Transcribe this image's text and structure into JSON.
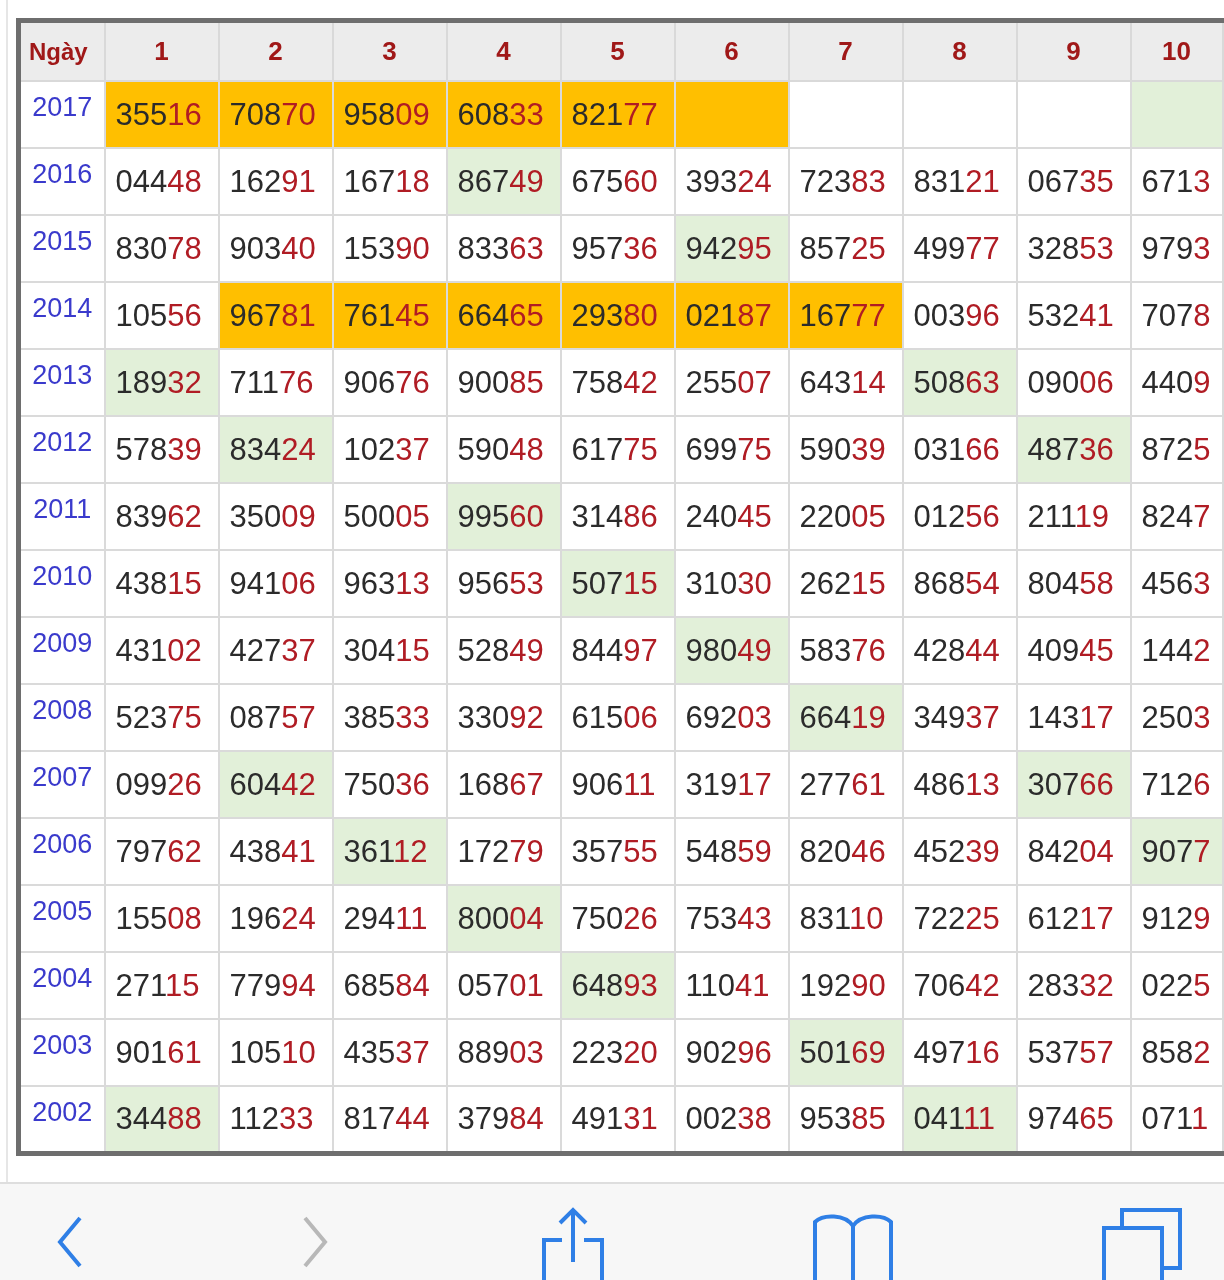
{
  "table": {
    "corner_label": "Ngày",
    "columns": [
      "1",
      "2",
      "3",
      "4",
      "5",
      "6",
      "7",
      "8",
      "9",
      "10"
    ],
    "rows": [
      {
        "year": "2017",
        "cells": [
          {
            "value": "35516",
            "color": "#ffbf00"
          },
          {
            "value": "70870",
            "color": "#ffbf00"
          },
          {
            "value": "95809",
            "color": "#ffbf00"
          },
          {
            "value": "60833",
            "color": "#ffbf00"
          },
          {
            "value": "82177",
            "color": "#ffbf00"
          },
          {
            "color": "#ffbf00"
          },
          {
            "color": "#ffffff"
          },
          {
            "color": "#ffffff"
          },
          {
            "color": "#ffffff"
          },
          {
            "color": "#e2f0d9"
          }
        ]
      },
      {
        "year": "2016",
        "cells": [
          {
            "value": "04448",
            "color": "#ffffff"
          },
          {
            "value": "16291",
            "color": "#ffffff"
          },
          {
            "value": "16718",
            "color": "#ffffff"
          },
          {
            "value": "86749",
            "color": "#e2f0d9"
          },
          {
            "value": "67560",
            "color": "#ffffff"
          },
          {
            "value": "39324",
            "color": "#ffffff"
          },
          {
            "value": "72383",
            "color": "#ffffff"
          },
          {
            "value": "83121",
            "color": "#ffffff"
          },
          {
            "value": "06735",
            "color": "#ffffff"
          },
          {
            "value": "6713",
            "color": "#ffffff"
          }
        ]
      },
      {
        "year": "2015",
        "cells": [
          {
            "value": "83078",
            "color": "#ffffff"
          },
          {
            "value": "90340",
            "color": "#ffffff"
          },
          {
            "value": "15390",
            "color": "#ffffff"
          },
          {
            "value": "83363",
            "color": "#ffffff"
          },
          {
            "value": "95736",
            "color": "#ffffff"
          },
          {
            "value": "94295",
            "color": "#e2f0d9"
          },
          {
            "value": "85725",
            "color": "#ffffff"
          },
          {
            "value": "49977",
            "color": "#ffffff"
          },
          {
            "value": "32853",
            "color": "#ffffff"
          },
          {
            "value": "9793",
            "color": "#ffffff"
          }
        ]
      },
      {
        "year": "2014",
        "cells": [
          {
            "value": "10556",
            "color": "#ffffff"
          },
          {
            "value": "96781",
            "color": "#ffbf00"
          },
          {
            "value": "76145",
            "color": "#ffbf00"
          },
          {
            "value": "66465",
            "color": "#ffbf00"
          },
          {
            "value": "29380",
            "color": "#ffbf00"
          },
          {
            "value": "02187",
            "color": "#ffbf00"
          },
          {
            "value": "16777",
            "color": "#ffbf00"
          },
          {
            "value": "00396",
            "color": "#ffffff"
          },
          {
            "value": "53241",
            "color": "#ffffff"
          },
          {
            "value": "7078",
            "color": "#ffffff"
          }
        ]
      },
      {
        "year": "2013",
        "cells": [
          {
            "value": "18932",
            "color": "#e2f0d9"
          },
          {
            "value": "71176",
            "color": "#ffffff"
          },
          {
            "value": "90676",
            "color": "#ffffff"
          },
          {
            "value": "90085",
            "color": "#ffffff"
          },
          {
            "value": "75842",
            "color": "#ffffff"
          },
          {
            "value": "25507",
            "color": "#ffffff"
          },
          {
            "value": "64314",
            "color": "#ffffff"
          },
          {
            "value": "50863",
            "color": "#e2f0d9"
          },
          {
            "value": "09006",
            "color": "#ffffff"
          },
          {
            "value": "4409",
            "color": "#ffffff"
          }
        ]
      },
      {
        "year": "2012",
        "cells": [
          {
            "value": "57839",
            "color": "#ffffff"
          },
          {
            "value": "83424",
            "color": "#e2f0d9"
          },
          {
            "value": "10237",
            "color": "#ffffff"
          },
          {
            "value": "59048",
            "color": "#ffffff"
          },
          {
            "value": "61775",
            "color": "#ffffff"
          },
          {
            "value": "69975",
            "color": "#ffffff"
          },
          {
            "value": "59039",
            "color": "#ffffff"
          },
          {
            "value": "03166",
            "color": "#ffffff"
          },
          {
            "value": "48736",
            "color": "#e2f0d9"
          },
          {
            "value": "8725",
            "color": "#ffffff"
          }
        ]
      },
      {
        "year": "2011",
        "cells": [
          {
            "value": "83962",
            "color": "#ffffff"
          },
          {
            "value": "35009",
            "color": "#ffffff"
          },
          {
            "value": "50005",
            "color": "#ffffff"
          },
          {
            "value": "99560",
            "color": "#e2f0d9"
          },
          {
            "value": "31486",
            "color": "#ffffff"
          },
          {
            "value": "24045",
            "color": "#ffffff"
          },
          {
            "value": "22005",
            "color": "#ffffff"
          },
          {
            "value": "01256",
            "color": "#ffffff"
          },
          {
            "value": "21119",
            "color": "#ffffff"
          },
          {
            "value": "8247",
            "color": "#ffffff"
          }
        ]
      },
      {
        "year": "2010",
        "cells": [
          {
            "value": "43815",
            "color": "#ffffff"
          },
          {
            "value": "94106",
            "color": "#ffffff"
          },
          {
            "value": "96313",
            "color": "#ffffff"
          },
          {
            "value": "95653",
            "color": "#ffffff"
          },
          {
            "value": "50715",
            "color": "#e2f0d9"
          },
          {
            "value": "31030",
            "color": "#ffffff"
          },
          {
            "value": "26215",
            "color": "#ffffff"
          },
          {
            "value": "86854",
            "color": "#ffffff"
          },
          {
            "value": "80458",
            "color": "#ffffff"
          },
          {
            "value": "4563",
            "color": "#ffffff"
          }
        ]
      },
      {
        "year": "2009",
        "cells": [
          {
            "value": "43102",
            "color": "#ffffff"
          },
          {
            "value": "42737",
            "color": "#ffffff"
          },
          {
            "value": "30415",
            "color": "#ffffff"
          },
          {
            "value": "52849",
            "color": "#ffffff"
          },
          {
            "value": "84497",
            "color": "#ffffff"
          },
          {
            "value": "98049",
            "color": "#e2f0d9"
          },
          {
            "value": "58376",
            "color": "#ffffff"
          },
          {
            "value": "42844",
            "color": "#ffffff"
          },
          {
            "value": "40945",
            "color": "#ffffff"
          },
          {
            "value": "1442",
            "color": "#ffffff"
          }
        ]
      },
      {
        "year": "2008",
        "cells": [
          {
            "value": "52375",
            "color": "#ffffff"
          },
          {
            "value": "08757",
            "color": "#ffffff"
          },
          {
            "value": "38533",
            "color": "#ffffff"
          },
          {
            "value": "33092",
            "color": "#ffffff"
          },
          {
            "value": "61506",
            "color": "#ffffff"
          },
          {
            "value": "69203",
            "color": "#ffffff"
          },
          {
            "value": "66419",
            "color": "#e2f0d9"
          },
          {
            "value": "34937",
            "color": "#ffffff"
          },
          {
            "value": "14317",
            "color": "#ffffff"
          },
          {
            "value": "2503",
            "color": "#ffffff"
          }
        ]
      },
      {
        "year": "2007",
        "cells": [
          {
            "value": "09926",
            "color": "#ffffff"
          },
          {
            "value": "60442",
            "color": "#e2f0d9"
          },
          {
            "value": "75036",
            "color": "#ffffff"
          },
          {
            "value": "16867",
            "color": "#ffffff"
          },
          {
            "value": "90611",
            "color": "#ffffff"
          },
          {
            "value": "31917",
            "color": "#ffffff"
          },
          {
            "value": "27761",
            "color": "#ffffff"
          },
          {
            "value": "48613",
            "color": "#ffffff"
          },
          {
            "value": "30766",
            "color": "#e2f0d9"
          },
          {
            "value": "7126",
            "color": "#ffffff"
          }
        ]
      },
      {
        "year": "2006",
        "cells": [
          {
            "value": "79762",
            "color": "#ffffff"
          },
          {
            "value": "43841",
            "color": "#ffffff"
          },
          {
            "value": "36112",
            "color": "#e2f0d9"
          },
          {
            "value": "17279",
            "color": "#ffffff"
          },
          {
            "value": "35755",
            "color": "#ffffff"
          },
          {
            "value": "54859",
            "color": "#ffffff"
          },
          {
            "value": "82046",
            "color": "#ffffff"
          },
          {
            "value": "45239",
            "color": "#ffffff"
          },
          {
            "value": "84204",
            "color": "#ffffff"
          },
          {
            "value": "9077",
            "color": "#e2f0d9"
          }
        ]
      },
      {
        "year": "2005",
        "cells": [
          {
            "value": "15508",
            "color": "#ffffff"
          },
          {
            "value": "19624",
            "color": "#ffffff"
          },
          {
            "value": "29411",
            "color": "#ffffff"
          },
          {
            "value": "80004",
            "color": "#e2f0d9"
          },
          {
            "value": "75026",
            "color": "#ffffff"
          },
          {
            "value": "75343",
            "color": "#ffffff"
          },
          {
            "value": "83110",
            "color": "#ffffff"
          },
          {
            "value": "72225",
            "color": "#ffffff"
          },
          {
            "value": "61217",
            "color": "#ffffff"
          },
          {
            "value": "9129",
            "color": "#ffffff"
          }
        ]
      },
      {
        "year": "2004",
        "cells": [
          {
            "value": "27115",
            "color": "#ffffff"
          },
          {
            "value": "77994",
            "color": "#ffffff"
          },
          {
            "value": "68584",
            "color": "#ffffff"
          },
          {
            "value": "05701",
            "color": "#ffffff"
          },
          {
            "value": "64893",
            "color": "#e2f0d9"
          },
          {
            "value": "11041",
            "color": "#ffffff"
          },
          {
            "value": "19290",
            "color": "#ffffff"
          },
          {
            "value": "70642",
            "color": "#ffffff"
          },
          {
            "value": "28332",
            "color": "#ffffff"
          },
          {
            "value": "0225",
            "color": "#ffffff"
          }
        ]
      },
      {
        "year": "2003",
        "cells": [
          {
            "value": "90161",
            "color": "#ffffff"
          },
          {
            "value": "10510",
            "color": "#ffffff"
          },
          {
            "value": "43537",
            "color": "#ffffff"
          },
          {
            "value": "88903",
            "color": "#ffffff"
          },
          {
            "value": "22320",
            "color": "#ffffff"
          },
          {
            "value": "90296",
            "color": "#ffffff"
          },
          {
            "value": "50169",
            "color": "#e2f0d9"
          },
          {
            "value": "49716",
            "color": "#ffffff"
          },
          {
            "value": "53757",
            "color": "#ffffff"
          },
          {
            "value": "8582",
            "color": "#ffffff"
          }
        ]
      },
      {
        "year": "2002",
        "cells": [
          {
            "value": "34488",
            "color": "#e2f0d9"
          },
          {
            "value": "11233",
            "color": "#ffffff"
          },
          {
            "value": "81744",
            "color": "#ffffff"
          },
          {
            "value": "37984",
            "color": "#ffffff"
          },
          {
            "value": "49131",
            "color": "#ffffff"
          },
          {
            "value": "00238",
            "color": "#ffffff"
          },
          {
            "value": "95385",
            "color": "#ffffff"
          },
          {
            "value": "04111",
            "color": "#e2f0d9"
          },
          {
            "value": "97465",
            "color": "#ffffff"
          },
          {
            "value": "0711",
            "color": "#ffffff"
          }
        ]
      }
    ]
  },
  "toolbar": {
    "buttons": [
      {
        "kind": "back",
        "disabled": false
      },
      {
        "kind": "forward",
        "disabled": true
      },
      {
        "kind": "share",
        "disabled": false
      },
      {
        "kind": "bookmarks",
        "disabled": false
      },
      {
        "kind": "tabs",
        "disabled": false
      }
    ]
  }
}
